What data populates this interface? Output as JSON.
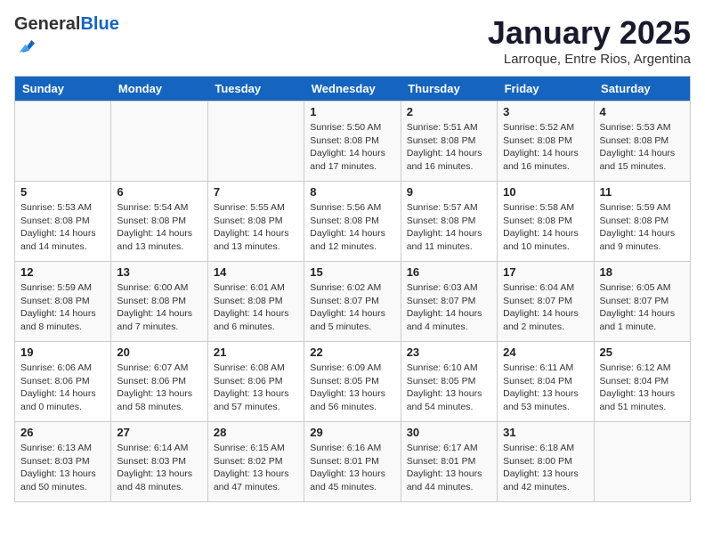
{
  "header": {
    "logo_general": "General",
    "logo_blue": "Blue",
    "title": "January 2025",
    "subtitle": "Larroque, Entre Rios, Argentina"
  },
  "weekdays": [
    "Sunday",
    "Monday",
    "Tuesday",
    "Wednesday",
    "Thursday",
    "Friday",
    "Saturday"
  ],
  "weeks": [
    [
      {
        "day": "",
        "info": ""
      },
      {
        "day": "",
        "info": ""
      },
      {
        "day": "",
        "info": ""
      },
      {
        "day": "1",
        "info": "Sunrise: 5:50 AM\nSunset: 8:08 PM\nDaylight: 14 hours and 17 minutes."
      },
      {
        "day": "2",
        "info": "Sunrise: 5:51 AM\nSunset: 8:08 PM\nDaylight: 14 hours and 16 minutes."
      },
      {
        "day": "3",
        "info": "Sunrise: 5:52 AM\nSunset: 8:08 PM\nDaylight: 14 hours and 16 minutes."
      },
      {
        "day": "4",
        "info": "Sunrise: 5:53 AM\nSunset: 8:08 PM\nDaylight: 14 hours and 15 minutes."
      }
    ],
    [
      {
        "day": "5",
        "info": "Sunrise: 5:53 AM\nSunset: 8:08 PM\nDaylight: 14 hours and 14 minutes."
      },
      {
        "day": "6",
        "info": "Sunrise: 5:54 AM\nSunset: 8:08 PM\nDaylight: 14 hours and 13 minutes."
      },
      {
        "day": "7",
        "info": "Sunrise: 5:55 AM\nSunset: 8:08 PM\nDaylight: 14 hours and 13 minutes."
      },
      {
        "day": "8",
        "info": "Sunrise: 5:56 AM\nSunset: 8:08 PM\nDaylight: 14 hours and 12 minutes."
      },
      {
        "day": "9",
        "info": "Sunrise: 5:57 AM\nSunset: 8:08 PM\nDaylight: 14 hours and 11 minutes."
      },
      {
        "day": "10",
        "info": "Sunrise: 5:58 AM\nSunset: 8:08 PM\nDaylight: 14 hours and 10 minutes."
      },
      {
        "day": "11",
        "info": "Sunrise: 5:59 AM\nSunset: 8:08 PM\nDaylight: 14 hours and 9 minutes."
      }
    ],
    [
      {
        "day": "12",
        "info": "Sunrise: 5:59 AM\nSunset: 8:08 PM\nDaylight: 14 hours and 8 minutes."
      },
      {
        "day": "13",
        "info": "Sunrise: 6:00 AM\nSunset: 8:08 PM\nDaylight: 14 hours and 7 minutes."
      },
      {
        "day": "14",
        "info": "Sunrise: 6:01 AM\nSunset: 8:08 PM\nDaylight: 14 hours and 6 minutes."
      },
      {
        "day": "15",
        "info": "Sunrise: 6:02 AM\nSunset: 8:07 PM\nDaylight: 14 hours and 5 minutes."
      },
      {
        "day": "16",
        "info": "Sunrise: 6:03 AM\nSunset: 8:07 PM\nDaylight: 14 hours and 4 minutes."
      },
      {
        "day": "17",
        "info": "Sunrise: 6:04 AM\nSunset: 8:07 PM\nDaylight: 14 hours and 2 minutes."
      },
      {
        "day": "18",
        "info": "Sunrise: 6:05 AM\nSunset: 8:07 PM\nDaylight: 14 hours and 1 minute."
      }
    ],
    [
      {
        "day": "19",
        "info": "Sunrise: 6:06 AM\nSunset: 8:06 PM\nDaylight: 14 hours and 0 minutes."
      },
      {
        "day": "20",
        "info": "Sunrise: 6:07 AM\nSunset: 8:06 PM\nDaylight: 13 hours and 58 minutes."
      },
      {
        "day": "21",
        "info": "Sunrise: 6:08 AM\nSunset: 8:06 PM\nDaylight: 13 hours and 57 minutes."
      },
      {
        "day": "22",
        "info": "Sunrise: 6:09 AM\nSunset: 8:05 PM\nDaylight: 13 hours and 56 minutes."
      },
      {
        "day": "23",
        "info": "Sunrise: 6:10 AM\nSunset: 8:05 PM\nDaylight: 13 hours and 54 minutes."
      },
      {
        "day": "24",
        "info": "Sunrise: 6:11 AM\nSunset: 8:04 PM\nDaylight: 13 hours and 53 minutes."
      },
      {
        "day": "25",
        "info": "Sunrise: 6:12 AM\nSunset: 8:04 PM\nDaylight: 13 hours and 51 minutes."
      }
    ],
    [
      {
        "day": "26",
        "info": "Sunrise: 6:13 AM\nSunset: 8:03 PM\nDaylight: 13 hours and 50 minutes."
      },
      {
        "day": "27",
        "info": "Sunrise: 6:14 AM\nSunset: 8:03 PM\nDaylight: 13 hours and 48 minutes."
      },
      {
        "day": "28",
        "info": "Sunrise: 6:15 AM\nSunset: 8:02 PM\nDaylight: 13 hours and 47 minutes."
      },
      {
        "day": "29",
        "info": "Sunrise: 6:16 AM\nSunset: 8:01 PM\nDaylight: 13 hours and 45 minutes."
      },
      {
        "day": "30",
        "info": "Sunrise: 6:17 AM\nSunset: 8:01 PM\nDaylight: 13 hours and 44 minutes."
      },
      {
        "day": "31",
        "info": "Sunrise: 6:18 AM\nSunset: 8:00 PM\nDaylight: 13 hours and 42 minutes."
      },
      {
        "day": "",
        "info": ""
      }
    ]
  ]
}
